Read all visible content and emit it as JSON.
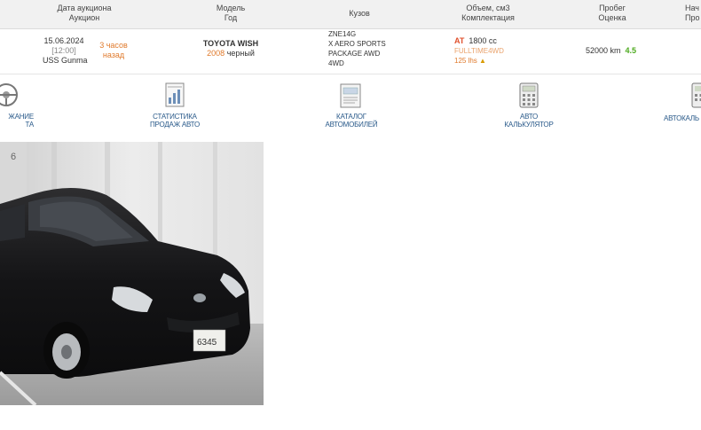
{
  "header": {
    "col_date": [
      "Дата аукциона",
      "Аукцион"
    ],
    "col_model": [
      "Модель",
      "Год"
    ],
    "col_body": "Кузов",
    "col_volume": [
      "Объем, см3",
      "Комплектация"
    ],
    "col_mileage": [
      "Пробег",
      "Оценка"
    ],
    "col_start": [
      "Нач",
      "Про"
    ]
  },
  "lot": {
    "date": "15.06.2024",
    "time": "[12:00]",
    "auction": "USS Gunma",
    "ago_line1": "3 часов",
    "ago_line2": "назад",
    "model": "TOYOTA WISH",
    "year": "2008",
    "color": "черный",
    "body_code": "ZNE14G",
    "trim_line1": "X AERO SPORTS",
    "trim_line2": "PACKAGE AWD",
    "trim_line3": "4WD",
    "transmission": "AT",
    "volume": "1800 cc",
    "drive": "FULLTIME4WD",
    "power": "125 lhs",
    "mileage": "52000 km",
    "score": "4.5"
  },
  "nav": [
    {
      "label_1": "ЖАНИЕ",
      "label_2": "ТА"
    },
    {
      "label_1": "СТАТИСТИКА",
      "label_2": "ПРОДАЖ АВТО"
    },
    {
      "label_1": "КАТАЛОГ",
      "label_2": "АВТОМОБИЛЕЙ"
    },
    {
      "label_1": "АВТО",
      "label_2": "КАЛЬКУЛЯТОР"
    },
    {
      "label_1": "АВТОКАЛЬ",
      "label_2": ""
    }
  ],
  "colors": {
    "accent_orange": "#e07a2c",
    "score_green": "#4caa1e",
    "link_blue": "#2a5a8a",
    "header_bg": "#f1f1f1"
  },
  "photo": {
    "plate_text": "6345"
  }
}
